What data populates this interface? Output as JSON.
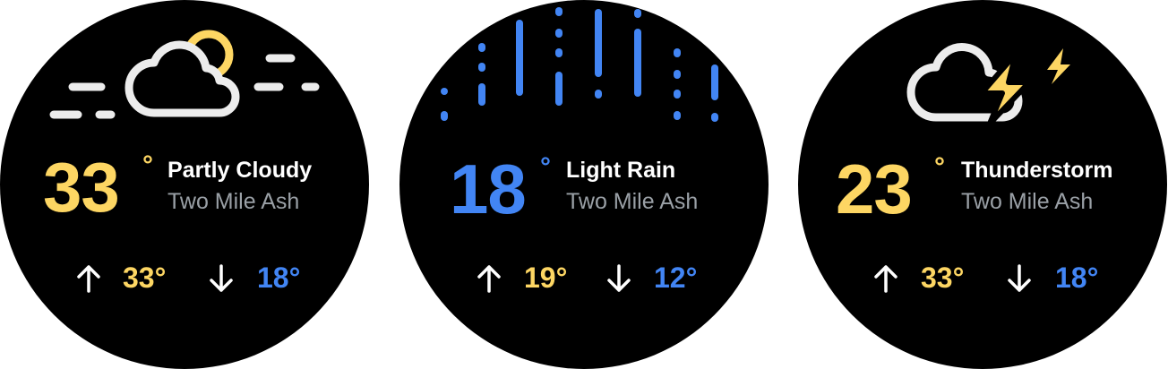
{
  "colors": {
    "background": "#000000",
    "yellow": "#fdd663",
    "blue": "#4285f4",
    "white": "#ffffff",
    "gray": "#9aa0a6"
  },
  "faces": [
    {
      "temperature": "33",
      "degree": "°",
      "condition": "Partly Cloudy",
      "location": "Two Mile Ash",
      "high": "33°",
      "low": "18°",
      "temp_color": "yellow",
      "icon": "partly-cloudy-icon"
    },
    {
      "temperature": "18",
      "degree": "°",
      "condition": "Light Rain",
      "location": "Two Mile Ash",
      "high": "19°",
      "low": "12°",
      "temp_color": "blue",
      "icon": "rain-icon"
    },
    {
      "temperature": "23",
      "degree": "°",
      "condition": "Thunderstorm",
      "location": "Two Mile Ash",
      "high": "33°",
      "low": "18°",
      "temp_color": "yellow",
      "icon": "thunderstorm-icon"
    }
  ],
  "icons": {
    "up": "arrow-up-icon",
    "down": "arrow-down-icon"
  }
}
